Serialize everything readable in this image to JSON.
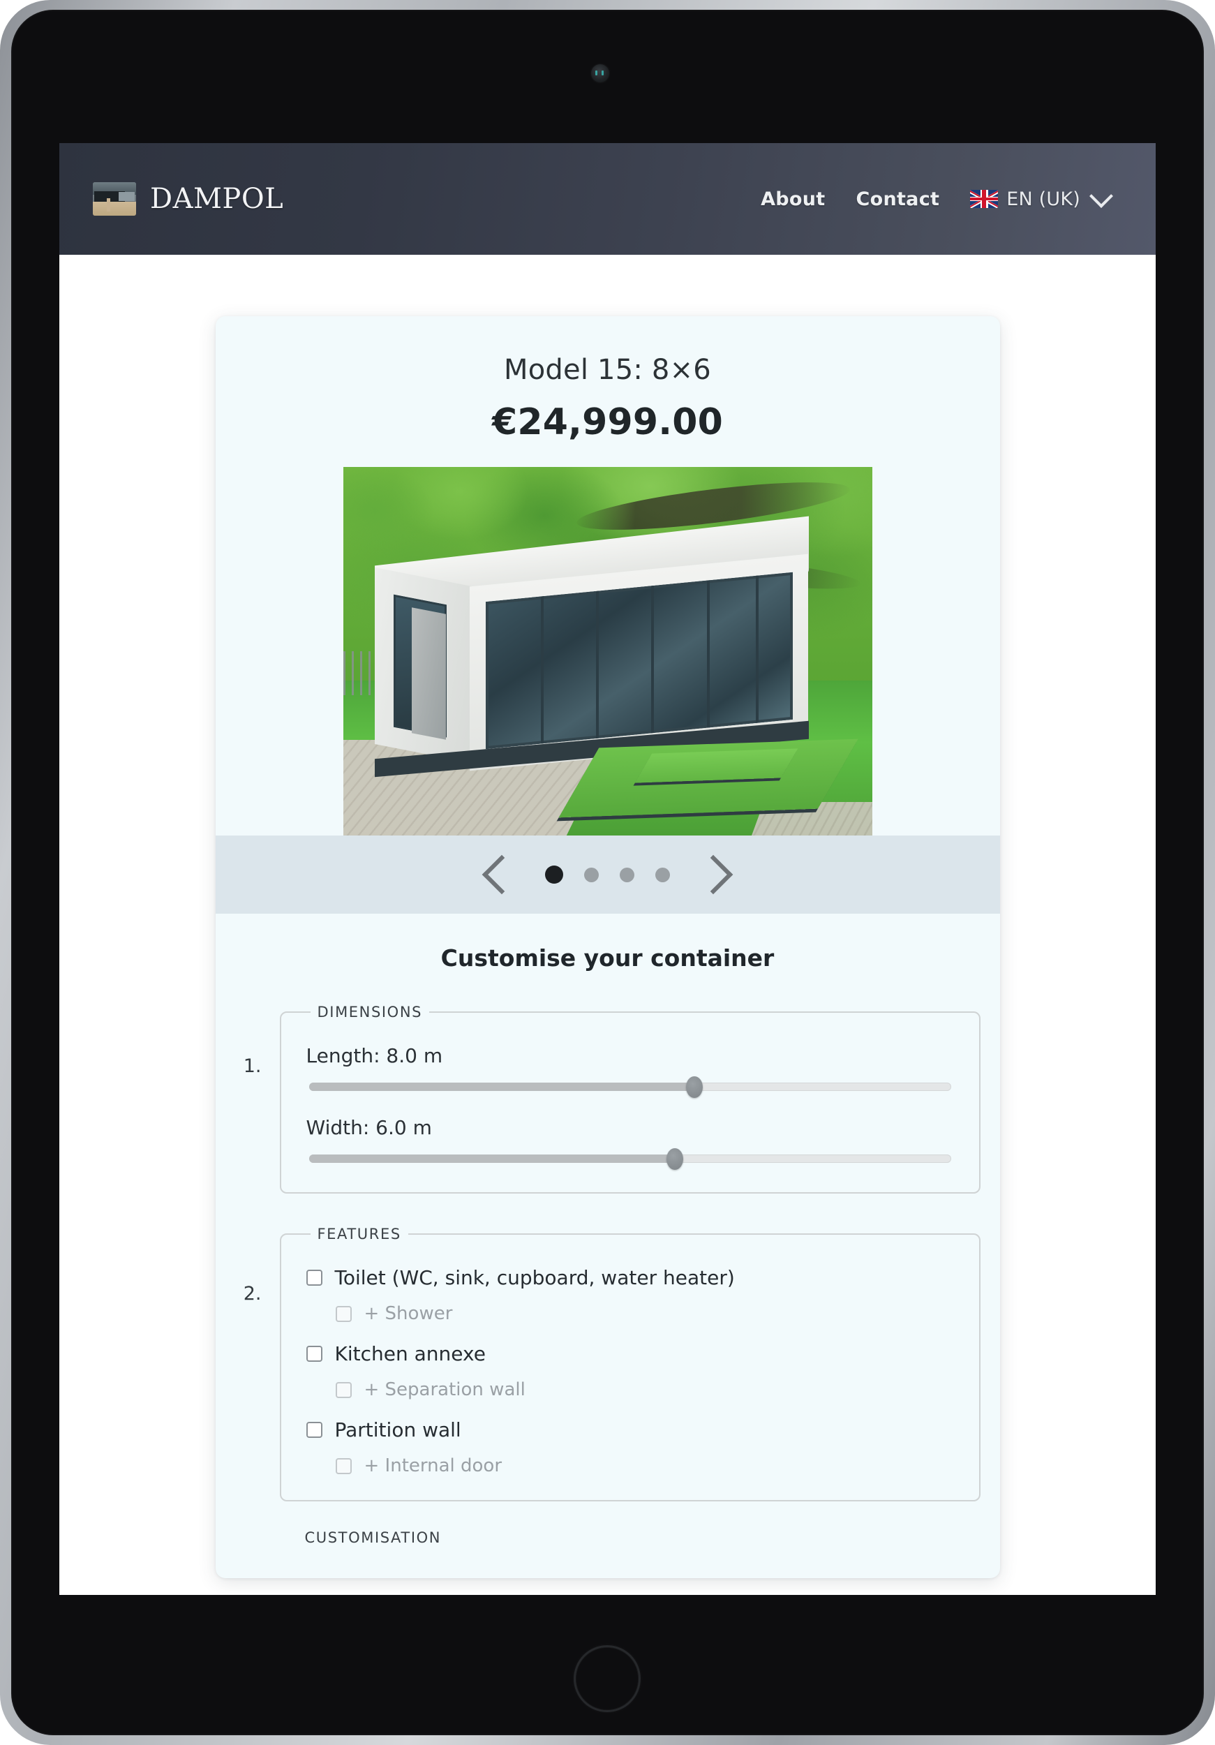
{
  "header": {
    "brand_name": "Dampol",
    "logo_icon": "container-building-photo-icon",
    "nav": [
      {
        "label": "About",
        "name": "nav-about"
      },
      {
        "label": "Contact",
        "name": "nav-contact"
      }
    ],
    "language": {
      "flag_icon": "uk-flag-icon",
      "label": "EN (UK)",
      "chevron_icon": "chevron-down-icon"
    },
    "colors": {
      "gradient_start": "#2e333f",
      "gradient_end": "#53586a",
      "text": "#eef0f2"
    }
  },
  "product": {
    "title": "Model 15: 8×6",
    "price": "€24,999.00",
    "image_alt": "modular-container-house-photo"
  },
  "carousel": {
    "prev_icon": "chevron-left-icon",
    "next_icon": "chevron-right-icon",
    "dot_count": 4,
    "active_index": 0,
    "track_color": "#dbe5eb"
  },
  "customise": {
    "heading": "Customise your container",
    "steps": [
      {
        "number": "1.",
        "legend": "DIMENSIONS",
        "sliders": [
          {
            "label": "Length: 8.0 m",
            "value": 8.0,
            "unit": "m",
            "percent": 60
          },
          {
            "label": "Width: 6.0 m",
            "value": 6.0,
            "unit": "m",
            "percent": 57
          }
        ]
      },
      {
        "number": "2.",
        "legend": "FEATURES",
        "options": [
          {
            "label": "Toilet (WC, sink, cupboard, water heater)",
            "checked": false,
            "disabled": false,
            "sub": false
          },
          {
            "label": "+ Shower",
            "checked": false,
            "disabled": true,
            "sub": true
          },
          {
            "label": "Kitchen annexe",
            "checked": false,
            "disabled": false,
            "sub": false
          },
          {
            "label": "+ Separation wall",
            "checked": false,
            "disabled": true,
            "sub": true
          },
          {
            "label": "Partition wall",
            "checked": false,
            "disabled": false,
            "sub": false
          },
          {
            "label": "+ Internal door",
            "checked": false,
            "disabled": true,
            "sub": true
          }
        ]
      }
    ],
    "next_legend_partial": "CUSTOMISATION"
  },
  "theme": {
    "card_bg": "#f2fafc",
    "page_bg": "#ffffff",
    "text_dark": "#20262b",
    "border": "#cfd3d4"
  }
}
